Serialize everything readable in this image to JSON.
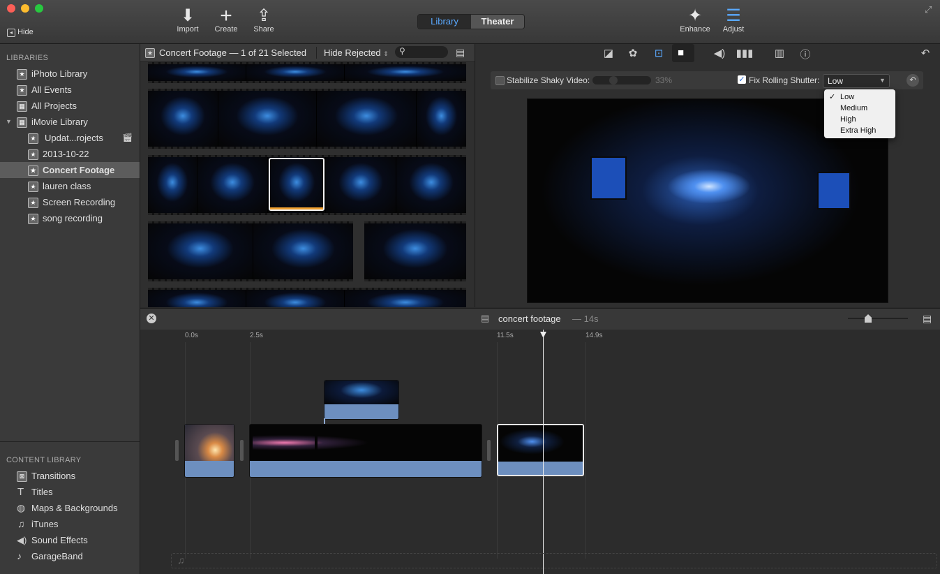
{
  "toolbar": {
    "hide_label": "Hide",
    "import_label": "Import",
    "create_label": "Create",
    "share_label": "Share",
    "library_tab": "Library",
    "theater_tab": "Theater",
    "enhance_label": "Enhance",
    "adjust_label": "Adjust"
  },
  "sidebar": {
    "libraries_header": "LIBRARIES",
    "items": [
      {
        "label": "iPhoto Library",
        "icon": "star-icon"
      },
      {
        "label": "All Events",
        "icon": "star-icon"
      },
      {
        "label": "All Projects",
        "icon": "grid-icon"
      },
      {
        "label": "iMovie Library",
        "icon": "grid-icon"
      },
      {
        "label": "Updat...rojects",
        "icon": "star-icon"
      },
      {
        "label": "2013-10-22",
        "icon": "star-icon"
      },
      {
        "label": "Concert Footage",
        "icon": "star-icon"
      },
      {
        "label": "lauren class",
        "icon": "star-icon"
      },
      {
        "label": "Screen Recording",
        "icon": "star-icon"
      },
      {
        "label": "song recording",
        "icon": "star-icon"
      }
    ],
    "content_header": "CONTENT LIBRARY",
    "content_items": [
      {
        "label": "Transitions",
        "icon": "transitions-icon"
      },
      {
        "label": "Titles",
        "icon": "titles-icon"
      },
      {
        "label": "Maps & Backgrounds",
        "icon": "globe-icon"
      },
      {
        "label": "iTunes",
        "icon": "music-note-icon"
      },
      {
        "label": "Sound Effects",
        "icon": "speaker-icon"
      },
      {
        "label": "GarageBand",
        "icon": "guitar-icon"
      }
    ]
  },
  "browser": {
    "title": "Concert Footage — 1 of 21 Selected",
    "filter": "Hide Rejected"
  },
  "viewer": {
    "stabilize_label": "Stabilize Shaky Video:",
    "stabilize_value": "33%",
    "rolling_label": "Fix Rolling Shutter:",
    "rolling_value": "Low",
    "menu_options": [
      "Low",
      "Medium",
      "High",
      "Extra High"
    ],
    "menu_check": "✓"
  },
  "timeline": {
    "project_name": "concert footage",
    "duration": "— 14s",
    "ticks": [
      {
        "label": "0.0s"
      },
      {
        "label": "2.5s"
      },
      {
        "label": "11.5s"
      },
      {
        "label": "14.9s"
      }
    ]
  },
  "colors": {
    "accent": "#3d8de0",
    "selection_orange": "#f0a030",
    "audio_blue": "#6d8fbf"
  }
}
